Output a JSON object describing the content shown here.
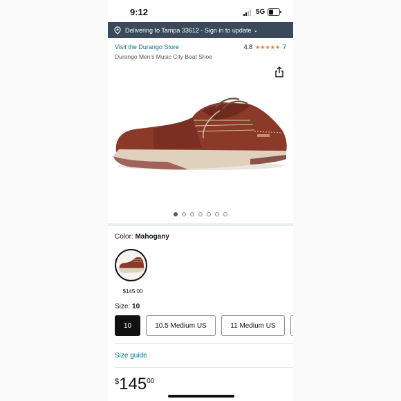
{
  "status_bar": {
    "time": "9:12",
    "network": "5G"
  },
  "delivery_bar": {
    "text": "Delivering to Tampa 33612 - Sign in to update"
  },
  "store": {
    "link_text": "Visit the Durango Store",
    "product_name": "Durango Men's Music City Boat Shoe"
  },
  "rating": {
    "value": "4.8",
    "count": "7",
    "stars": 5
  },
  "gallery": {
    "image_count": 7,
    "active_index": 0
  },
  "color": {
    "label": "Color:",
    "value": "Mahogany",
    "swatch_price": "$145.00"
  },
  "size": {
    "label": "Size:",
    "value": "10",
    "options": [
      {
        "label": "10",
        "selected": true
      },
      {
        "label": "10.5 Medium US",
        "selected": false
      },
      {
        "label": "11 Medium US",
        "selected": false
      }
    ]
  },
  "size_guide": "Size guide",
  "price": {
    "currency": "$",
    "whole": "145",
    "fraction": "00"
  },
  "colors": {
    "link": "#007185",
    "star": "#de7921",
    "delivery_bar": "#3a4a5a",
    "selected_size_bg": "#111111"
  },
  "icons": [
    "location-pin-icon",
    "share-icon",
    "battery-icon",
    "signal-icon"
  ]
}
